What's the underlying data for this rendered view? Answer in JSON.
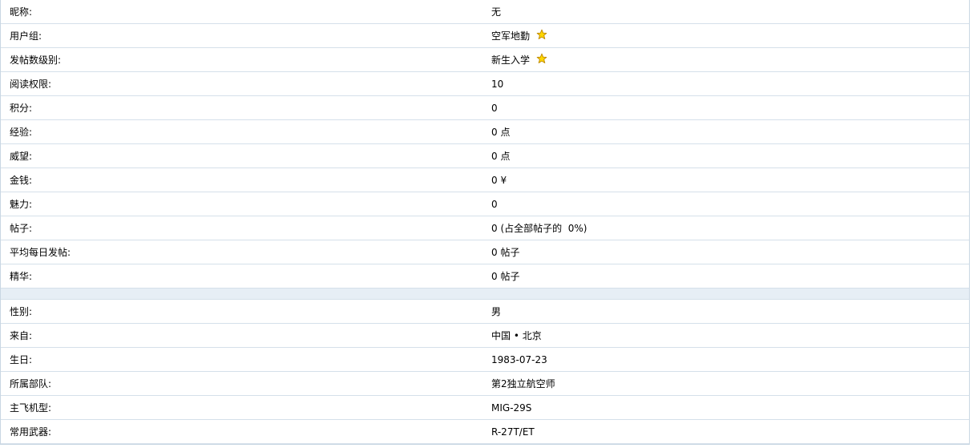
{
  "stats": [
    {
      "label": "昵称:",
      "value": "无"
    },
    {
      "label": "用户组:",
      "value": "空军地勤",
      "icon": "star-icon"
    },
    {
      "label": "发帖数级别:",
      "value": "新生入学",
      "icon": "star-icon"
    },
    {
      "label": "阅读权限:",
      "value": "10"
    },
    {
      "label": "积分:",
      "value": "0"
    },
    {
      "label": "经验:",
      "value": "0 点"
    },
    {
      "label": "威望:",
      "value": "0 点"
    },
    {
      "label": "金钱:",
      "value": "0 ¥"
    },
    {
      "label": "魅力:",
      "value": "0"
    },
    {
      "label": "帖子:",
      "value": "0 (占全部帖子的  0%)"
    },
    {
      "label": "平均每日发帖:",
      "value": "0 帖子"
    },
    {
      "label": "精华:",
      "value": "0 帖子"
    }
  ],
  "profile": [
    {
      "label": "性别:",
      "value": "男"
    },
    {
      "label": "来自:",
      "value": "中国 • 北京"
    },
    {
      "label": "生日:",
      "value": "1983-07-23"
    },
    {
      "label": "所属部队:",
      "value": "第2独立航空师"
    },
    {
      "label": "主飞机型:",
      "value": "MIG-29S"
    },
    {
      "label": "常用武器:",
      "value": "R-27T/ET"
    }
  ],
  "colors": {
    "star_fill": "#ffd700",
    "star_stroke": "#c08a00",
    "separator": "#e6eef5",
    "row_border": "#d5e0ea"
  }
}
